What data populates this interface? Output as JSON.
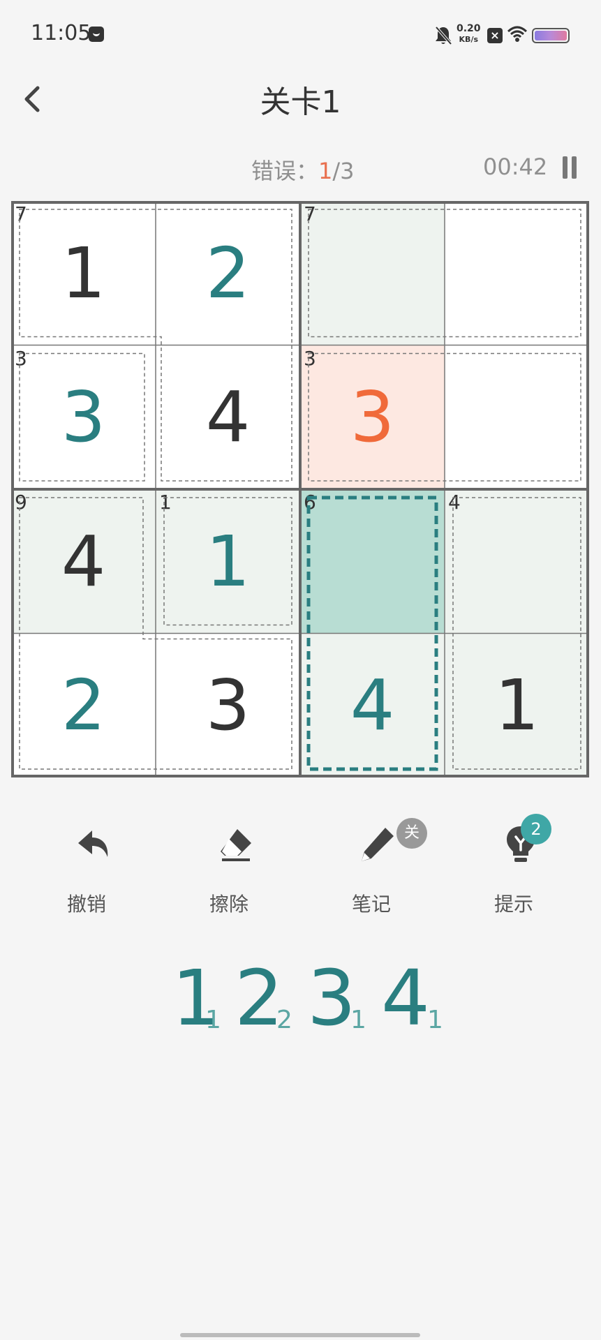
{
  "status_bar": {
    "time": "11:05",
    "speed_value": "0.20",
    "speed_unit": "KB/s",
    "icons": [
      "notification-app-icon",
      "bell-muted-icon",
      "close-box-icon",
      "wifi-icon",
      "battery-icon"
    ]
  },
  "header": {
    "title": "关卡1",
    "back_icon": "chevron-left-icon"
  },
  "info": {
    "errors_label": "错误：",
    "errors_current": "1",
    "errors_sep_max": "/3",
    "timer": "00:42",
    "pause_icon": "pause-icon"
  },
  "board": {
    "size": 4,
    "cells": [
      [
        {
          "value": "1",
          "kind": "given"
        },
        {
          "value": "2",
          "kind": "user"
        },
        {
          "value": "",
          "kind": "empty"
        },
        {
          "value": "",
          "kind": "empty"
        }
      ],
      [
        {
          "value": "3",
          "kind": "user"
        },
        {
          "value": "4",
          "kind": "given"
        },
        {
          "value": "3",
          "kind": "error"
        },
        {
          "value": "",
          "kind": "empty"
        }
      ],
      [
        {
          "value": "4",
          "kind": "given"
        },
        {
          "value": "1",
          "kind": "user"
        },
        {
          "value": "",
          "kind": "empty"
        },
        {
          "value": "",
          "kind": "empty"
        }
      ],
      [
        {
          "value": "2",
          "kind": "user"
        },
        {
          "value": "3",
          "kind": "given"
        },
        {
          "value": "4",
          "kind": "user"
        },
        {
          "value": "1",
          "kind": "given"
        }
      ]
    ],
    "cage_sums": [
      {
        "row": 0,
        "col": 0,
        "sum": "7"
      },
      {
        "row": 0,
        "col": 2,
        "sum": "7"
      },
      {
        "row": 1,
        "col": 0,
        "sum": "3"
      },
      {
        "row": 1,
        "col": 2,
        "sum": "3"
      },
      {
        "row": 2,
        "col": 0,
        "sum": "9"
      },
      {
        "row": 2,
        "col": 1,
        "sum": "1"
      },
      {
        "row": 2,
        "col": 2,
        "sum": "6"
      },
      {
        "row": 2,
        "col": 3,
        "sum": "4"
      }
    ],
    "selected_cell": {
      "row": 2,
      "col": 2
    },
    "colors": {
      "highlight": "#eef3ef",
      "selected": "#b8ddd3",
      "error_bg": "#fde8e1",
      "cage_selected_border": "#2a7e80"
    }
  },
  "tools": [
    {
      "label": "撤销",
      "icon": "undo-icon"
    },
    {
      "label": "擦除",
      "icon": "eraser-icon"
    },
    {
      "label": "笔记",
      "icon": "pencil-icon",
      "badge": "关"
    },
    {
      "label": "提示",
      "icon": "lightbulb-icon",
      "badge": "2"
    }
  ],
  "numbers": [
    {
      "value": "1",
      "remaining": "1"
    },
    {
      "value": "2",
      "remaining": "2"
    },
    {
      "value": "3",
      "remaining": "1"
    },
    {
      "value": "4",
      "remaining": "1"
    }
  ]
}
